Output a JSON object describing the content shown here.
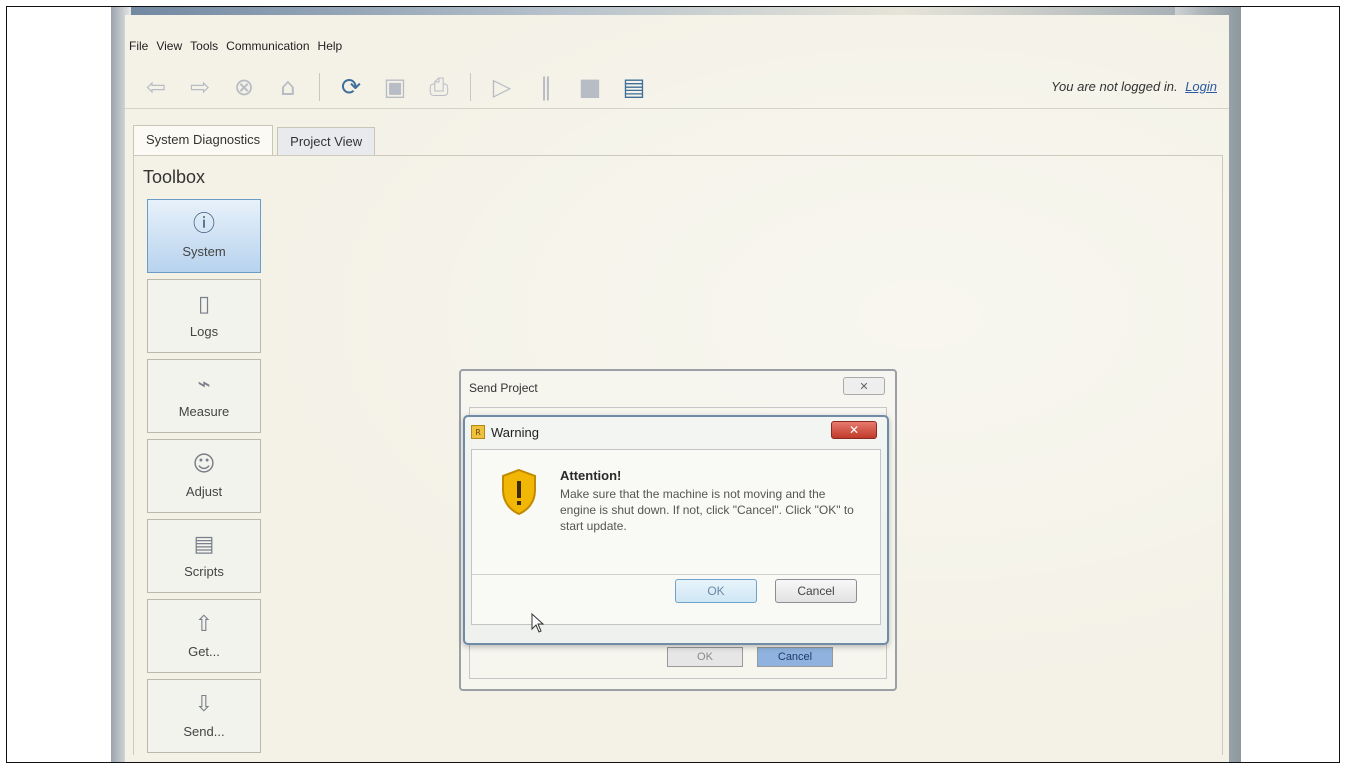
{
  "menu": {
    "items": [
      "File",
      "View",
      "Tools",
      "Communication",
      "Help"
    ]
  },
  "toolbar": {
    "buttons": [
      {
        "icon": "back-arrow-icon",
        "glyph": "⇦"
      },
      {
        "icon": "forward-arrow-icon",
        "glyph": "⇨"
      },
      {
        "icon": "stop-icon",
        "glyph": "⊗"
      },
      {
        "icon": "home-icon",
        "glyph": "⌂"
      },
      {
        "icon": "refresh-icon",
        "glyph": "⟳"
      },
      {
        "icon": "save-icon",
        "glyph": "▣"
      },
      {
        "icon": "print-icon",
        "glyph": "⎙"
      },
      {
        "icon": "play-icon",
        "glyph": "▷"
      },
      {
        "icon": "pause-icon",
        "glyph": "‖"
      },
      {
        "icon": "stop-square-icon",
        "glyph": "■"
      },
      {
        "icon": "panel-icon",
        "glyph": "▤"
      }
    ],
    "login_status": "You are not logged in.",
    "login_link": "Login"
  },
  "tabs": {
    "items": [
      "System Diagnostics",
      "Project View"
    ],
    "selected": "System Diagnostics"
  },
  "toolbox": {
    "title": "Toolbox",
    "items": [
      {
        "label": "System",
        "icon": "info-icon",
        "glyph": "ⓘ",
        "active": true
      },
      {
        "label": "Logs",
        "icon": "notebook-icon",
        "glyph": "▯",
        "active": false
      },
      {
        "label": "Measure",
        "icon": "chart-icon",
        "glyph": "⌁",
        "active": false
      },
      {
        "label": "Adjust",
        "icon": "person-icon",
        "glyph": "☺",
        "active": false
      },
      {
        "label": "Scripts",
        "icon": "script-icon",
        "glyph": "▤",
        "active": false
      },
      {
        "label": "Get...",
        "icon": "up-arrow-icon",
        "glyph": "⇧",
        "active": false
      },
      {
        "label": "Send...",
        "icon": "down-arrow-icon",
        "glyph": "⇩",
        "active": false
      }
    ]
  },
  "send_dialog": {
    "title": "Send Project",
    "close_glyph": "✕",
    "ok_label": "OK",
    "cancel_label": "Cancel"
  },
  "warning_dialog": {
    "title": "Warning",
    "heading": "Attention!",
    "message": "Make sure that the machine is not moving and the engine is shut down. If not, click \"Cancel\". Click \"OK\" to start update.",
    "ok_label": "OK",
    "cancel_label": "Cancel",
    "close_glyph": "✕"
  },
  "colors": {
    "accent": "#3b5a7a",
    "warning_shield": "#f0b400",
    "close_red": "#c13a2b"
  }
}
